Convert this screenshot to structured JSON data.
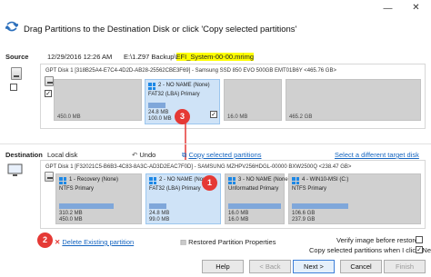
{
  "window": {
    "title": "Drag Partitions to the Destination Disk or click 'Copy selected partitions'",
    "minimize": "—",
    "close": "✕"
  },
  "source": {
    "label": "Source",
    "date": "12/29/2016 12:26 AM",
    "path_prefix": "E:\\1.Z97 Backup\\",
    "path_file": "EFI_System-00-00.mrimg",
    "disk_header": "GPT Disk 1 [318B25A4-E7C4-4D2D-AB28-25562CBE3F69] - Samsung SSD 850 EVO 500GB EMT01B6Y  <465.76 GB>",
    "partitions": [
      {
        "size_text": "450.0 MB"
      },
      {
        "title": "2 - NO NAME (None)",
        "fs": "FAT32 (LBA) Primary",
        "used": "24.8 MB",
        "total": "100.0 MB",
        "fill_pct": 25
      },
      {
        "size_text": "16.0 MB"
      },
      {
        "size_text": "465.2 GB"
      }
    ]
  },
  "destination": {
    "label": "Destination",
    "type": "Local disk",
    "undo": "Undo",
    "copy_selected": "Copy selected partitions",
    "select_target": "Select a different target disk",
    "disk_header": "GPT Disk 1 [F32021C5-B6B3-4C83-8A3C-AD3D2EAC7F0D] - SAMSUNG MZHPV256HDGL-00000 BXW2500Q  <238.47 GB>",
    "partitions": [
      {
        "title": "1 - Recovery (None)",
        "fs": "NTFS Primary",
        "used": "310.2 MB",
        "total": "450.0 MB",
        "fill_pct": 69,
        "selected": false
      },
      {
        "title": "2 - NO NAME (None)",
        "fs": "FAT32 (LBA) Primary",
        "used": "24.8 MB",
        "total": "99.0 MB",
        "fill_pct": 25,
        "selected": true
      },
      {
        "title": "3 - NO NAME (None)",
        "fs": "Unformatted Primary",
        "used": "16.0 MB",
        "total": "16.0 MB",
        "fill_pct": 100,
        "selected": false
      },
      {
        "title": "4 - WIN10-MSI (C:)",
        "fs": "NTFS Primary",
        "used": "106.6 GB",
        "total": "237.9 GB",
        "fill_pct": 45,
        "selected": false
      }
    ]
  },
  "actions": {
    "delete_partition": "Delete Existing partition",
    "restored_properties": "Restored Partition Properties",
    "verify_image": "Verify image before restore",
    "copy_on_next": "Copy selected partitions when I click 'Next'"
  },
  "badges": {
    "one": "1",
    "two": "2",
    "three": "3"
  },
  "buttons": {
    "help": "Help",
    "back": "< Back",
    "next": "Next >",
    "cancel": "Cancel",
    "finish": "Finish"
  },
  "colors": {
    "accent": "#1565c0",
    "selected_partition": "#cfe3f7",
    "usage_bar": "#7fa7da",
    "badge": "#e53935",
    "highlight": "#ffff00"
  }
}
